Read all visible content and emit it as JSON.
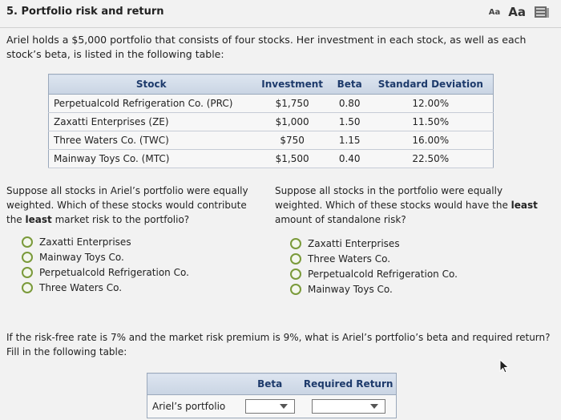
{
  "header": {
    "title": "5. Portfolio risk and return",
    "font_small": "Aa",
    "font_large": "Aa",
    "book_icon": "book-icon"
  },
  "intro": "Ariel holds a $5,000 portfolio that consists of four stocks. Her investment in each stock, as well as each stock’s beta, is listed in the following table:",
  "stock_table": {
    "columns": [
      "Stock",
      "Investment",
      "Beta",
      "Standard Deviation"
    ],
    "rows": [
      [
        "Perpetualcold Refrigeration Co. (PRC)",
        "$1,750",
        "0.80",
        "12.00%"
      ],
      [
        "Zaxatti Enterprises (ZE)",
        "$1,000",
        "1.50",
        "11.50%"
      ],
      [
        "Three Waters Co. (TWC)",
        "$750",
        "1.15",
        "16.00%"
      ],
      [
        "Mainway Toys Co. (MTC)",
        "$1,500",
        "0.40",
        "22.50%"
      ]
    ]
  },
  "question1": {
    "pre": "Suppose all stocks in Ariel’s portfolio were equally weighted. Which of these stocks would contribute the ",
    "bold": "least",
    "post": " market risk to the portfolio?",
    "options": [
      "Zaxatti Enterprises",
      "Mainway Toys Co.",
      "Perpetualcold Refrigeration Co.",
      "Three Waters Co."
    ]
  },
  "question2": {
    "pre": "Suppose all stocks in the portfolio were equally weighted. Which of these stocks would have the ",
    "bold": "least",
    "post": " amount of standalone risk?",
    "options": [
      "Zaxatti Enterprises",
      "Three Waters Co.",
      "Perpetualcold Refrigeration Co.",
      "Mainway Toys Co."
    ]
  },
  "question3": "If the risk-free rate is 7% and the market risk premium is 9%, what is Ariel’s portfolio’s beta and required return? Fill in the following table:",
  "portfolio_table": {
    "columns": [
      "",
      "Beta",
      "Required Return"
    ],
    "row_label": "Ariel’s portfolio",
    "beta_value": "",
    "return_value": ""
  },
  "colors": {
    "table_header_text": "#1d3a6b",
    "radio_border": "#7a9a3a",
    "background": "#f2f2f2"
  }
}
